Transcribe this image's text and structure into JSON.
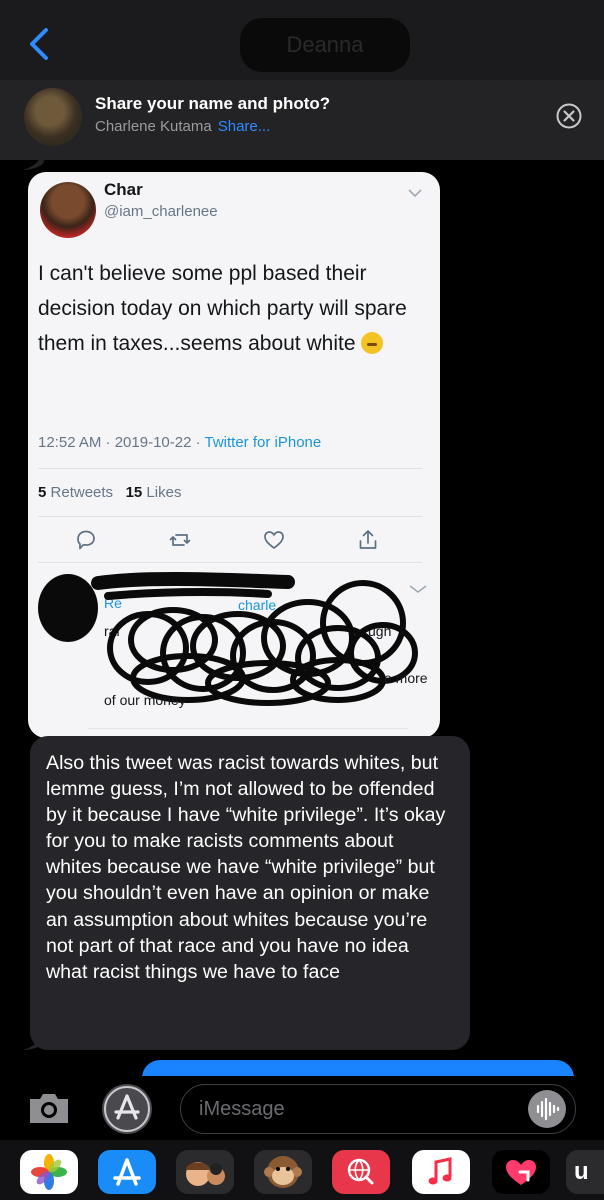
{
  "header": {
    "contact_name": "Deanna",
    "share": {
      "title": "Share your name and photo?",
      "name": "Charlene Kutama",
      "link": "Share..."
    }
  },
  "tweet": {
    "name": "Char",
    "handle": "@iam_charlenee",
    "text": "I can't believe some ppl based their decision today on which party will spare them in taxes...seems about white",
    "time": "12:52 AM · 2019-10-22 · ",
    "client": "Twitter for iPhone",
    "retweets_count": "5",
    "retweets_label": "Retweets",
    "likes_count": "15",
    "likes_label": "Likes",
    "reply_fragment_1": "e more",
    "reply_fragment_2": "of our money"
  },
  "message": {
    "text": "Also this tweet was racist towards whites, but lemme guess, I’m not allowed to be offended by it because I have “white privilege”. It’s okay for you to make racists comments about whites because we have “white privilege” but you shouldn’t even have an opinion or make an assumption about whites because you’re not part of that race and you have no idea what racist things we have to face"
  },
  "composer": {
    "placeholder": "iMessage"
  },
  "colors": {
    "accent": "#2e8bff",
    "received_bubble": "#26262a",
    "sent_bubble": "#1a84ff"
  }
}
